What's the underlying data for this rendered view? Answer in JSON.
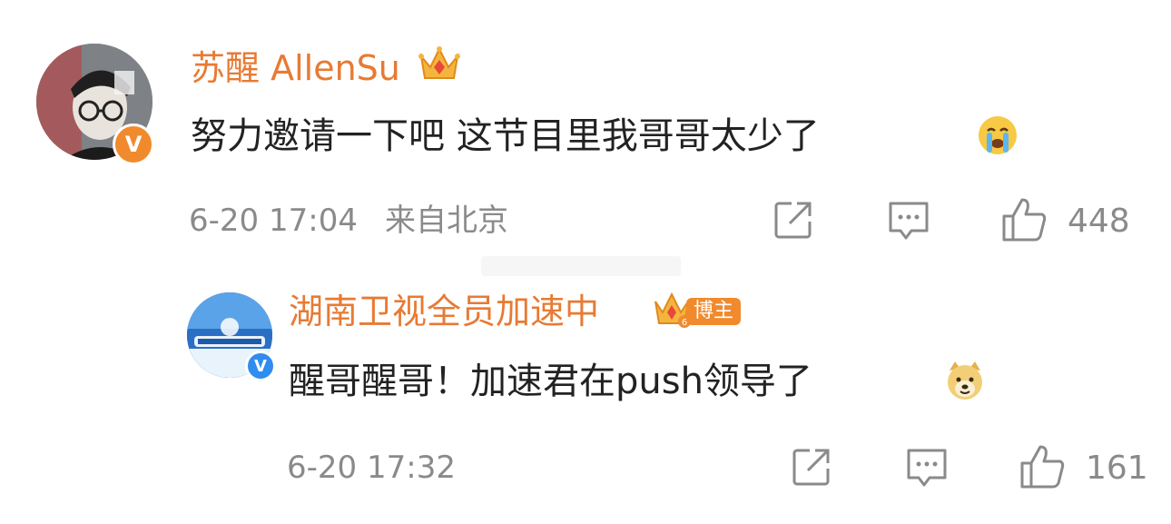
{
  "colors": {
    "name": "#e87a33",
    "meta": "#8a8a8a",
    "text": "#222222",
    "badge_orange": "#f18a2c",
    "badge_blue": "#2f8cf0"
  },
  "comment": {
    "author": "苏醒 AllenSu",
    "author_badge_icon": "crown-vip-icon",
    "verified_icon": "orange-v-verified-icon",
    "verified_mark": "V",
    "text": "努力邀请一下吧 这节目里我哥哥太少了",
    "emoji": "crying-emoji",
    "time": "6-20 17:04",
    "location": "来自北京",
    "actions": {
      "share_icon": "share-icon",
      "comment_icon": "comment-icon",
      "like_icon": "thumbs-up-icon",
      "likes": "448"
    }
  },
  "reply": {
    "author": "湖南卫视全员加速中",
    "author_badge_icon": "crown-vip-icon",
    "tag": "博主",
    "verified_icon": "blue-v-verified-icon",
    "verified_mark": "V",
    "text": "醒哥醒哥！加速君在push领导了",
    "emoji": "doge-emoji",
    "time": "6-20 17:32",
    "actions": {
      "share_icon": "share-icon",
      "comment_icon": "comment-icon",
      "like_icon": "thumbs-up-icon",
      "likes": "161"
    }
  }
}
